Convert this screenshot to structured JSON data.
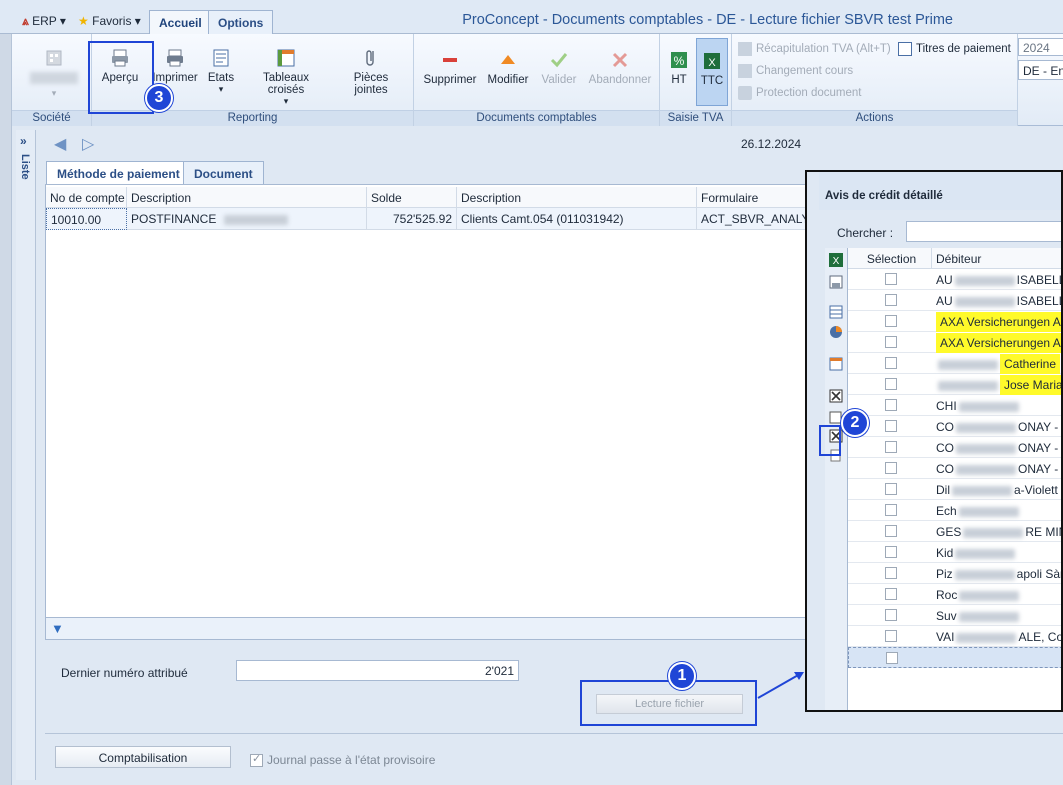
{
  "quick_access": {
    "erp": "ERP",
    "favoris": "Favoris"
  },
  "tabs": [
    "Accueil",
    "Options"
  ],
  "window_title": "ProConcept - Documents comptables - DE - Lecture fichier SBVR test Prime",
  "ribbon": {
    "societe": {
      "label": "Société"
    },
    "reporting": {
      "label": "Reporting",
      "apercu": "Aperçu",
      "imprimer": "Imprimer",
      "etats": "Etats",
      "tableaux": "Tableaux croisés",
      "pieces": "Pièces jointes"
    },
    "documents": {
      "label": "Documents comptables",
      "supprimer": "Supprimer",
      "modifier": "Modifier",
      "valider": "Valider",
      "abandonner": "Abandonner"
    },
    "saisie": {
      "label": "Saisie TVA",
      "ht": "HT",
      "ttc": "TTC"
    },
    "actions": {
      "label": "Actions",
      "recap": "Récapitulation TVA (Alt+T)",
      "changement": "Changement cours",
      "protection": "Protection document",
      "titres": "Titres de paiement"
    },
    "year": "2024",
    "lang": "DE - En"
  },
  "liste_label": "Liste",
  "date": "26.12.2024",
  "subtabs": [
    "Méthode de paiement",
    "Document"
  ],
  "grid": {
    "headers": [
      "No de compte",
      "Description",
      "Solde",
      "Description",
      "Formulaire"
    ],
    "row": {
      "account": "10010.00",
      "desc": "POSTFINANCE",
      "solde": "752'525.92",
      "desc2": "Clients Camt.054 (011031942)",
      "form": "ACT_SBVR_ANALYSE_E"
    }
  },
  "last_number": {
    "label": "Dernier numéro attribué",
    "value": "2'021"
  },
  "lecture_button": "Lecture fichier",
  "compta_button": "Comptabilisation",
  "journal_label": "Journal passe à l'état provisoire",
  "annotations": {
    "one": "1",
    "two": "2",
    "three": "3"
  },
  "popup": {
    "title": "Avis de crédit détaillé",
    "search_label": "Chercher :",
    "col_selection": "Sélection",
    "col_debiteur": "Débiteur",
    "rows": [
      {
        "pre": "AU",
        "post": "ISABELL",
        "yellow": false
      },
      {
        "pre": "AU",
        "post": "ISABELL",
        "yellow": false
      },
      {
        "pre": "",
        "post": "AXA Versicherungen AG",
        "yellow": true
      },
      {
        "pre": "",
        "post": "AXA Versicherungen AG",
        "yellow": true
      },
      {
        "pre": "",
        "post": "Catherine",
        "yellow": true
      },
      {
        "pre": "",
        "post": "Jose Maria",
        "yellow": true
      },
      {
        "pre": "CHI",
        "post": "",
        "yellow": false
      },
      {
        "pre": "CO",
        "post": "ONAY - S",
        "yellow": false
      },
      {
        "pre": "CO",
        "post": "ONAY - S",
        "yellow": false
      },
      {
        "pre": "CO",
        "post": "ONAY - S",
        "yellow": false
      },
      {
        "pre": "Dil",
        "post": "a-Violett",
        "yellow": false
      },
      {
        "pre": "Ech",
        "post": "",
        "yellow": false
      },
      {
        "pre": "GES",
        "post": "RE MING",
        "yellow": false
      },
      {
        "pre": "Kid",
        "post": "",
        "yellow": false
      },
      {
        "pre": "Piz",
        "post": "apoli Sàr",
        "yellow": false
      },
      {
        "pre": "Roc",
        "post": "",
        "yellow": false
      },
      {
        "pre": "Suv",
        "post": "",
        "yellow": false
      },
      {
        "pre": "VAI",
        "post": "ALE, Com",
        "yellow": false
      }
    ]
  },
  "colors": {
    "accent": "#2b5797",
    "annotation": "#1f45d6",
    "highlight": "#fffa2a"
  }
}
